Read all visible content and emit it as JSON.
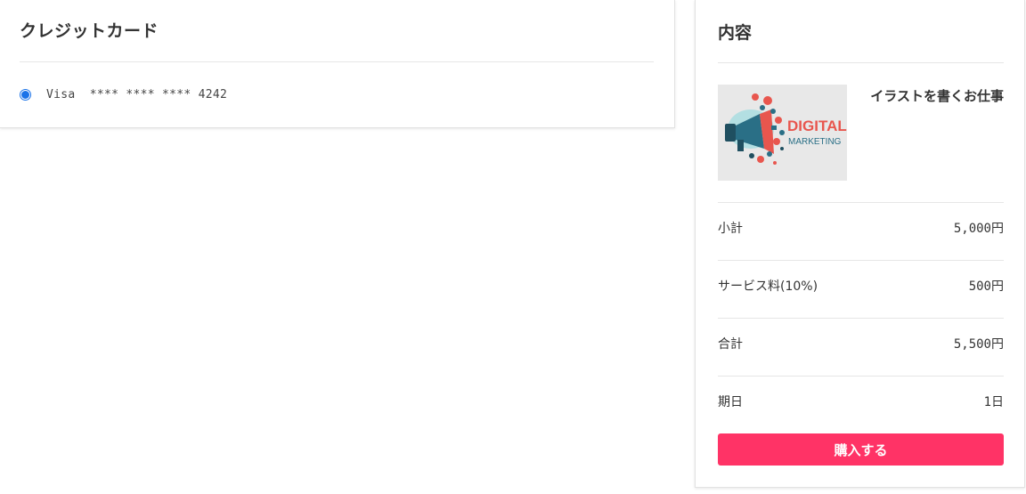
{
  "payment": {
    "title": "クレジットカード",
    "card": {
      "brand": "Visa",
      "masked_number": "**** **** **** 4242",
      "selected": true
    }
  },
  "summary": {
    "title": "内容",
    "product": {
      "name": "イラストを書くお仕事",
      "image_text_line1": "DIGITAL",
      "image_text_line2": "MARKETING"
    },
    "lines": [
      {
        "label": "小計",
        "value": "5,000円"
      },
      {
        "label": "サービス料(10%)",
        "value": "500円"
      },
      {
        "label": "合計",
        "value": "5,500円"
      },
      {
        "label": "期日",
        "value": "1日"
      }
    ],
    "buy_button_label": "購入する"
  },
  "colors": {
    "accent": "#ff3366",
    "radio": "#1a73e8",
    "image_red": "#e8564e",
    "image_teal": "#2a6f86"
  }
}
